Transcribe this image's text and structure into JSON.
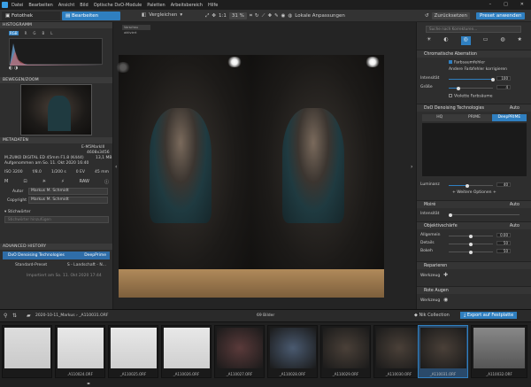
{
  "menu": {
    "items": [
      "Datei",
      "Bearbeiten",
      "Ansicht",
      "Bild",
      "Optische DxO-Module",
      "Paletten",
      "Arbeitsbereich",
      "Hilfe"
    ]
  },
  "toolbar": {
    "tab_fotothek": "Fotothek",
    "tab_bearbeiten": "Bearbeiten",
    "vergleichen": "Vergleichen",
    "zoom_ratio": "1:1",
    "zoom_percent": "31 %",
    "lokale": "Lokale Anpassungen",
    "zuruecksetzen": "Zurücksetzen",
    "preset": "Preset anwenden"
  },
  "left": {
    "histogram_title": "HISTOGRAMM",
    "histogram_channels": [
      "RGB",
      "R",
      "G",
      "B",
      "L"
    ],
    "zoom_title": "BEWEGEN/ZOOM",
    "meta_title": "METADATEN",
    "meta_camera": "E-M5MarkIII",
    "meta_resolution": "4608x3456",
    "meta_lens": "M.ZUIKO DIGITAL ED 45mm F1.8 (K444)",
    "meta_size": "13,1 MB",
    "meta_date": "Aufgenommen am So. 11. Okt 2020 16:40",
    "exif_iso": "ISO 3200",
    "exif_f": "f/8.0",
    "exif_shutter": "1/200 s",
    "exif_ev": "0 EV",
    "exif_focal": "45 mm",
    "exif_mode": "M",
    "exif_raw": "RAW",
    "autor_label": "Autor",
    "autor_value": "Markus M. Schmidt",
    "copyright_label": "Copyright",
    "copyright_value": "Markus M. Schmidt",
    "stichwoerter": "Stichwörter",
    "stichwoerter_placeholder": "Stichwörter hinzufügen",
    "history_title": "ADVANCED HISTORY",
    "hist1_name": "DxO Denoising Technologies",
    "hist1_val": "DeepPrime",
    "hist2_name": "Standard-Preset",
    "hist2_val": "S - Landschaft - N...",
    "hist_import": "Importiert am So. 11. Okt 2020 17:44"
  },
  "center": {
    "before_label": "Vorschau aktiviert"
  },
  "right": {
    "search_placeholder": "Suche nach Korrekturen...",
    "chrom_title": "Chromatische Aberration",
    "farbsaum": "Farbsaumfehler",
    "andere": "Andere Farbfehler korrigieren",
    "intensitaet": "Intensität",
    "intensitaet_val": "100",
    "groesse": "Größe",
    "groesse_val": "4",
    "violette": "Violette Farbsäume",
    "denoise_title": "DxO Denoising Technologies",
    "denoise_auto": "Auto",
    "mode_hq": "HQ",
    "mode_prime": "PRIME",
    "mode_deepprime": "DeepPRIME",
    "luminanz": "Luminanz",
    "luminanz_val": "40",
    "weitere": "+ Weitere Optionen +",
    "moire_title": "Moiré",
    "moire_auto": "Auto",
    "moire_int": "Intensität",
    "sharp_title": "Objektivschärfe",
    "sharp_auto": "Auto",
    "allgemein": "Allgemein",
    "allgemein_val": "0.00",
    "details": "Details",
    "details_val": "50",
    "bokeh": "Bokeh",
    "bokeh_val": "50",
    "repair_title": "Reparieren",
    "werkzeug": "Werkzeug",
    "redeye_title": "Rote Augen",
    "werkzeug2": "Werkzeug"
  },
  "filmstrip": {
    "path": "2020-10-11_Markus",
    "current": "_A110031.ORF",
    "count": "69 Bilder",
    "nik": "Nik Collection",
    "export": "Export auf Festplatte",
    "captions": [
      "",
      ".A110024.ORF",
      "_A110025.ORF",
      "_A110026.ORF",
      "_A110027.ORF",
      "_A110028.ORF",
      "_A110029.ORF",
      "_A110030.ORF",
      "_A110031.ORF",
      "_A110032.ORF"
    ]
  }
}
